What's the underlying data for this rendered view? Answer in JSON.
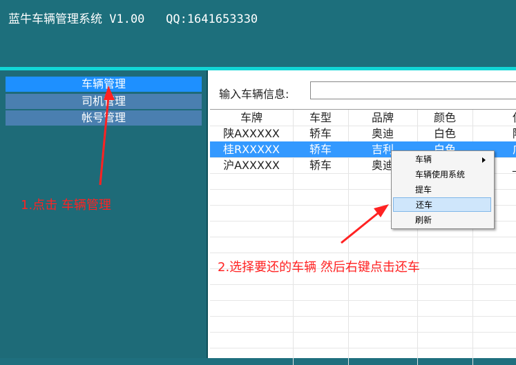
{
  "app": {
    "title": "蓝牛车辆管理系统 V1.00   QQ:1641653330"
  },
  "colors": {
    "header_bg": "#1d6f7c",
    "accent_strip": "#12d6d6",
    "sidebar_active": "#1e90ff",
    "sidebar_item": "#4a7fb0",
    "selected_row": "#3399ff",
    "annotation": "#ff2222"
  },
  "sidebar": {
    "items": [
      {
        "label": "车辆管理",
        "active": true
      },
      {
        "label": "司机管理",
        "active": false
      },
      {
        "label": "帐号管理",
        "active": false
      }
    ]
  },
  "search": {
    "label": "输入车辆信息:",
    "value": ""
  },
  "table": {
    "columns": [
      "车牌",
      "车型",
      "品牌",
      "颜色",
      "使"
    ],
    "rows": [
      [
        "陕AXXXXX",
        "轿车",
        "奥迪",
        "白色",
        "陕"
      ],
      [
        "桂RXXXXX",
        "轿车",
        "吉利",
        "白色",
        "广"
      ],
      [
        "沪AXXXXX",
        "轿车",
        "奥迪",
        "",
        "_"
      ]
    ],
    "selected_row": 1
  },
  "context_menu": {
    "items": [
      {
        "label": "车辆",
        "has_submenu": true
      },
      {
        "label": "车辆使用系统",
        "has_submenu": false
      },
      {
        "label": "提车",
        "has_submenu": false
      },
      {
        "label": "还车",
        "has_submenu": false,
        "highlighted": true
      },
      {
        "label": "刷新",
        "has_submenu": false
      }
    ]
  },
  "annotations": {
    "step1": "1.点击 车辆管理",
    "step2": "2.选择要还的车辆 然后右键点击还车"
  }
}
